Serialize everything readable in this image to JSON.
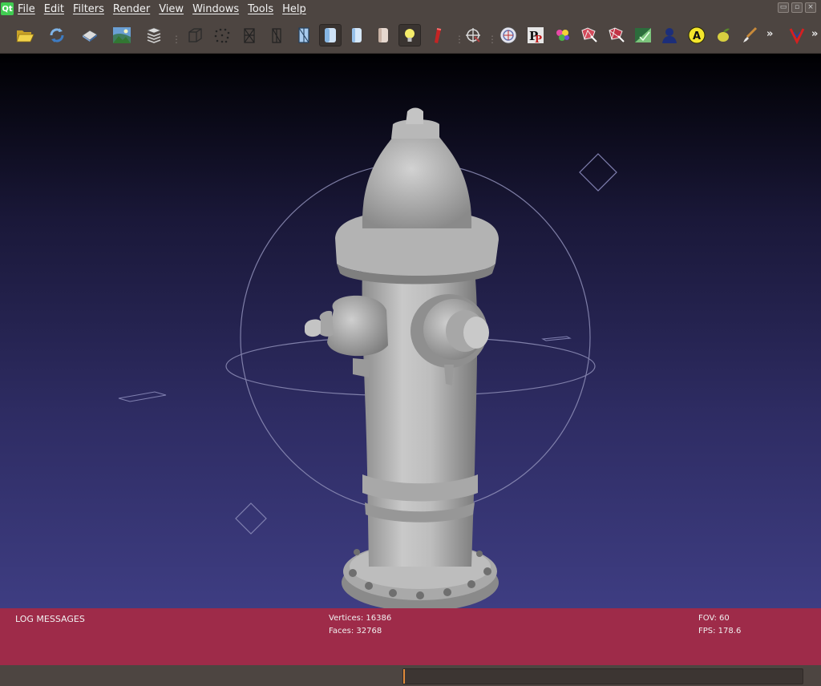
{
  "menubar": {
    "logo": "Qt",
    "items": [
      "File",
      "Edit",
      "Filters",
      "Render",
      "View",
      "Windows",
      "Tools",
      "Help"
    ]
  },
  "toolbar": {
    "buttons": [
      "open-folder-icon",
      "reload-icon",
      "save-icon",
      "snapshot-icon",
      "layers-icon",
      "bbox-icon",
      "points-icon",
      "wireframe-icon",
      "hidden-lines-icon",
      "flat-lines-icon",
      "flat-icon",
      "smooth-icon",
      "texture-icon",
      "light-icon",
      "color-icon",
      "trackball-icon",
      "measure-icon",
      "pickpoints-icon",
      "paint-icon",
      "select-vertices-icon",
      "select-faces-icon",
      "align-icon",
      "georef-icon",
      "annotation-icon",
      "fruit-icon",
      "brush-icon",
      "more-icon"
    ],
    "active": [
      "smooth-icon",
      "light-icon"
    ],
    "overflow_glyph": "»"
  },
  "info": {
    "log_title": "LOG MESSAGES",
    "vertices": "Vertices: 16386",
    "faces": "Faces: 32768",
    "fov": "FOV: 60",
    "fps": "FPS:   178.6"
  },
  "status": {
    "progress_percent": 0.5
  },
  "colors": {
    "menu_bg": "#4d4541",
    "info_bar": "#9e2b49",
    "viewport_top": "#000002",
    "viewport_bottom": "#3e3d82",
    "mesh": "#b9b9b9"
  }
}
